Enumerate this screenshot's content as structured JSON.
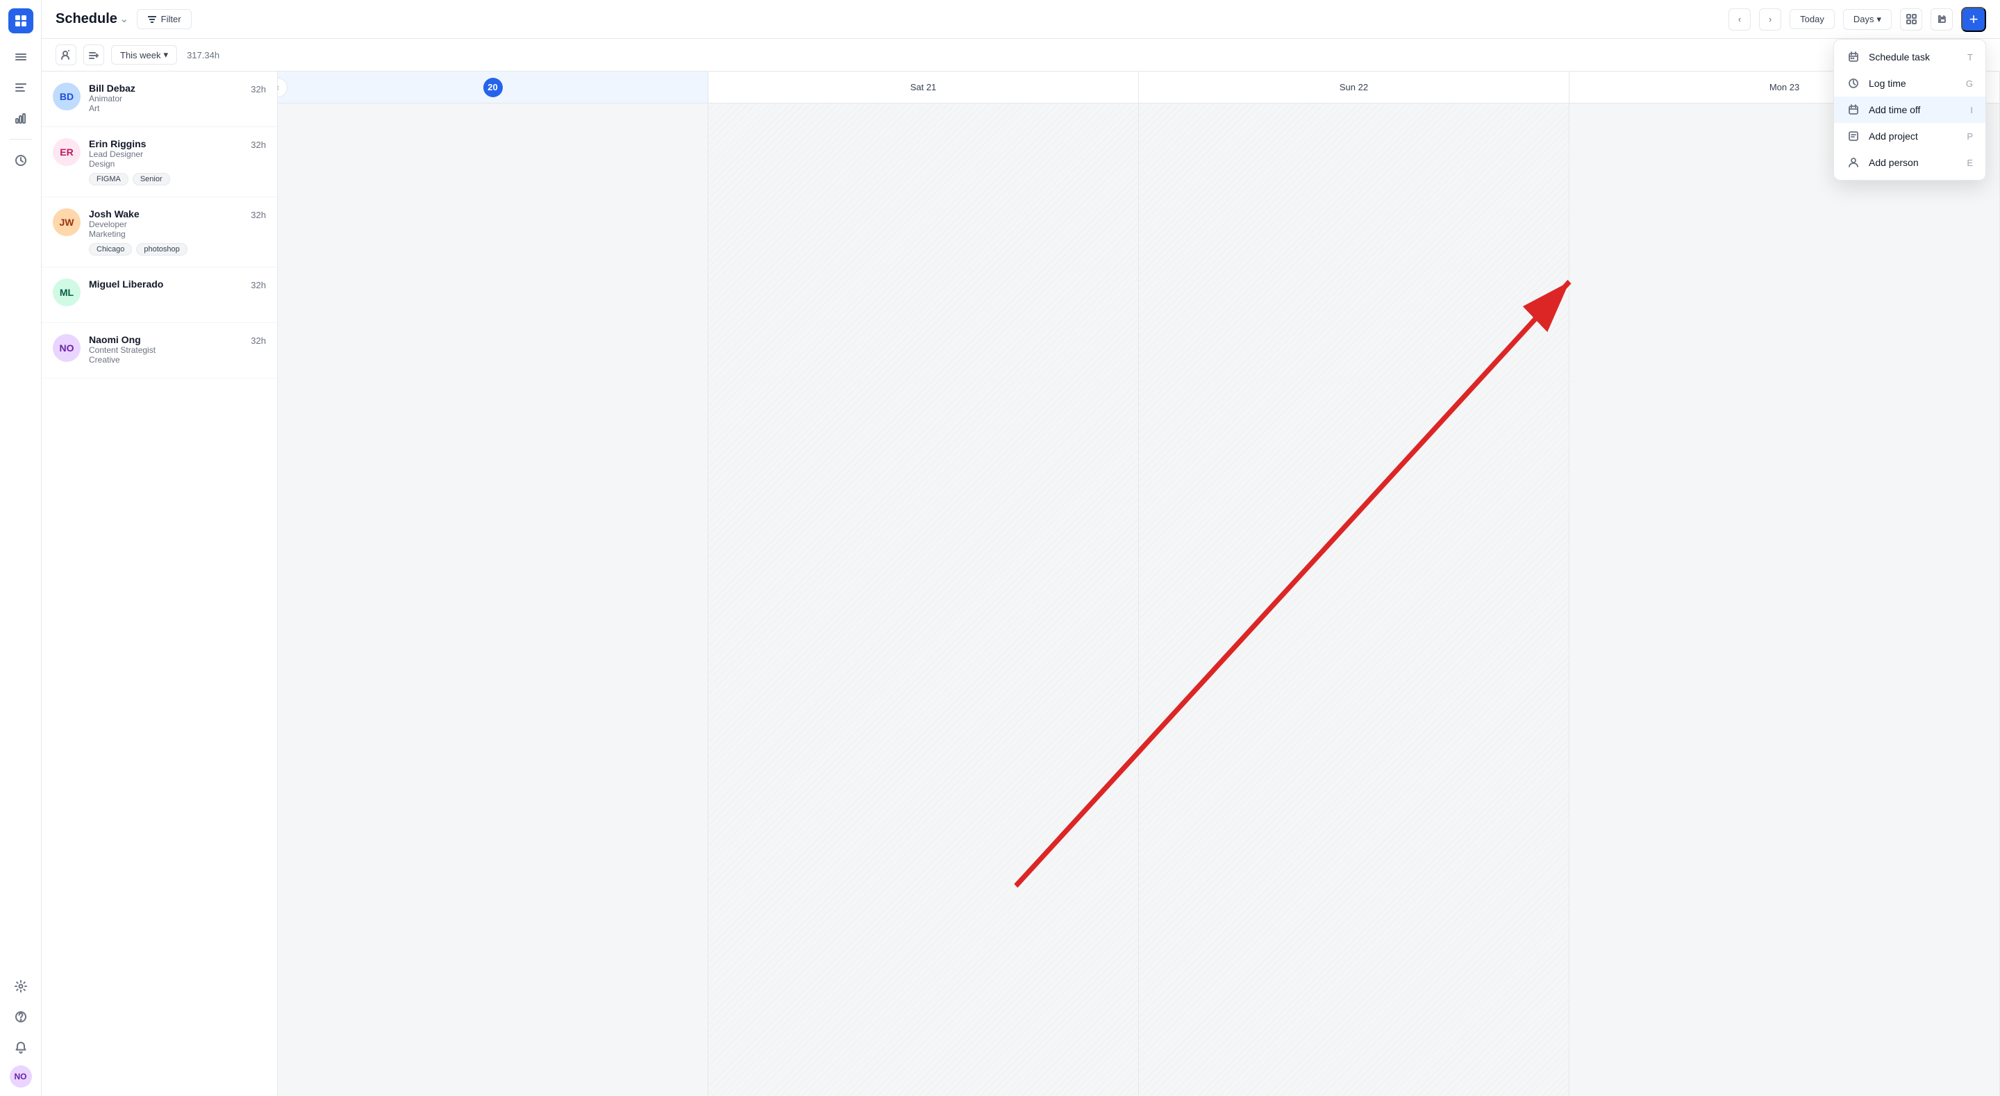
{
  "app": {
    "title": "Schedule",
    "filter_label": "Filter"
  },
  "header": {
    "nav_prev": "‹",
    "nav_next": "›",
    "today_label": "Today",
    "days_label": "Days",
    "add_label": "+"
  },
  "toolbar": {
    "week_label": "This week",
    "hours": "317.34h"
  },
  "calendar": {
    "columns": [
      {
        "id": "fri20",
        "label": "20",
        "day": "",
        "today": true
      },
      {
        "id": "sat21",
        "label": "Sat 21",
        "today": false,
        "weekend": true
      },
      {
        "id": "sun22",
        "label": "Sun 22",
        "today": false,
        "weekend": true
      },
      {
        "id": "mon23",
        "label": "Mon 23",
        "today": false
      }
    ]
  },
  "people": [
    {
      "id": 1,
      "name": "Bill Debaz",
      "role": "Animator",
      "dept": "Art",
      "tags": [],
      "hours": "32h",
      "avatar_initials": "BD",
      "avatar_class": "av-blue"
    },
    {
      "id": 2,
      "name": "Erin Riggins",
      "role": "Lead Designer",
      "dept": "Design",
      "tags": [
        "FIGMA",
        "Senior"
      ],
      "hours": "32h",
      "avatar_initials": "ER",
      "avatar_class": "av-pink"
    },
    {
      "id": 3,
      "name": "Josh Wake",
      "role": "Developer",
      "dept": "Marketing",
      "tags": [
        "Chicago",
        "photoshop"
      ],
      "hours": "32h",
      "avatar_initials": "JW",
      "avatar_class": "av-orange"
    },
    {
      "id": 4,
      "name": "Miguel Liberado",
      "role": "",
      "dept": "",
      "tags": [],
      "hours": "32h",
      "avatar_initials": "ML",
      "avatar_class": "av-green"
    },
    {
      "id": 5,
      "name": "Naomi Ong",
      "role": "Content Strategist",
      "dept": "Creative",
      "tags": [],
      "hours": "32h",
      "avatar_initials": "NO",
      "avatar_class": "av-purple"
    }
  ],
  "dropdown": {
    "items": [
      {
        "id": "schedule-task",
        "label": "Schedule task",
        "shortcut": "T",
        "icon": "schedule"
      },
      {
        "id": "log-time",
        "label": "Log time",
        "shortcut": "G",
        "icon": "clock"
      },
      {
        "id": "add-time-off",
        "label": "Add time off",
        "shortcut": "I",
        "icon": "calendar-off",
        "highlighted": true
      },
      {
        "id": "add-project",
        "label": "Add project",
        "shortcut": "P",
        "icon": "project"
      },
      {
        "id": "add-person",
        "label": "Add person",
        "shortcut": "E",
        "icon": "person"
      }
    ]
  },
  "sidebar": {
    "icons": [
      "menu",
      "list",
      "chart",
      "clock",
      "settings",
      "help",
      "bell"
    ]
  }
}
